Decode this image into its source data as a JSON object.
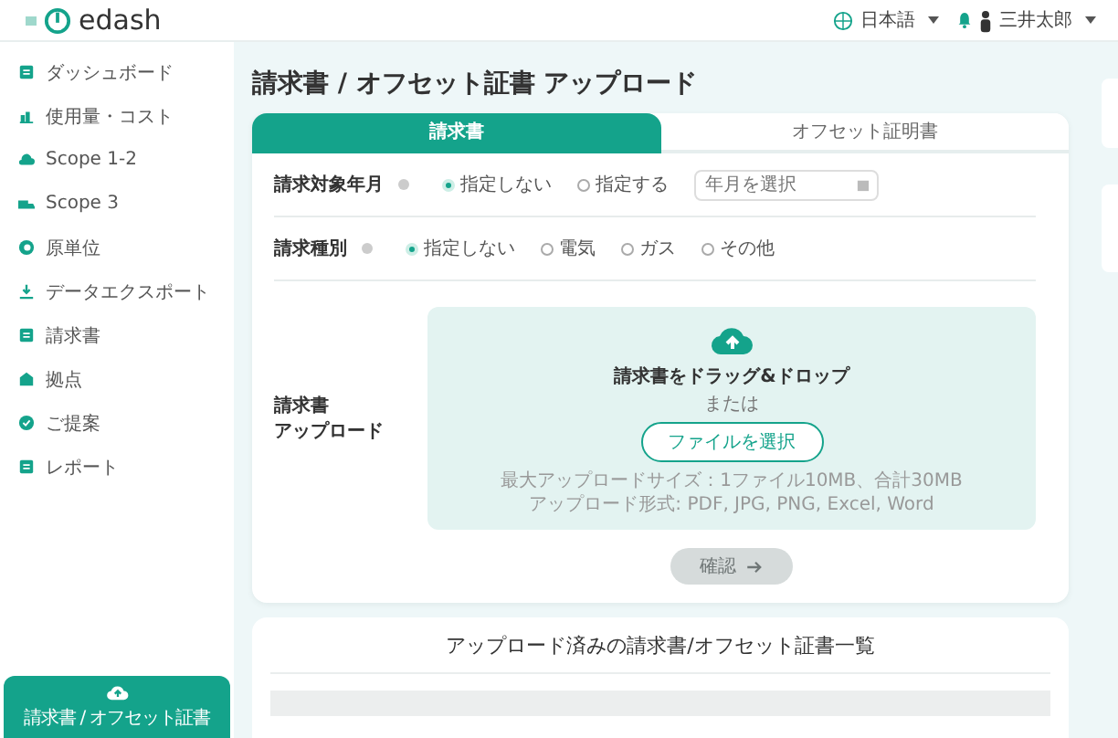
{
  "header": {
    "logo": "edash",
    "language": "日本語",
    "user": "三井太郎"
  },
  "sidebar": {
    "items": [
      {
        "label": "ダッシュボード",
        "selected": false
      },
      {
        "label": "使用量・コスト",
        "selected": false
      },
      {
        "label": "Scope 1-2",
        "selected": false
      },
      {
        "label": "Scope 3",
        "selected": false
      },
      {
        "label": "原単位",
        "selected": false
      },
      {
        "label": "データエクスポート",
        "selected": false
      },
      {
        "label": "請求書",
        "selected": false
      },
      {
        "label": "拠点",
        "selected": false
      },
      {
        "label": "ご提案",
        "selected": false
      },
      {
        "label": "レポート",
        "selected": false
      }
    ],
    "upload_button": "請求書 / オフセット証書"
  },
  "page_title": "請求書 / オフセット証書 アップロード",
  "tabs": [
    {
      "label": "請求書",
      "selected": true
    },
    {
      "label": "オフセット証明書",
      "selected": false
    }
  ],
  "form": {
    "rows": [
      {
        "label": "請求対象年月",
        "options": [
          {
            "label": "指定しない",
            "selected": true
          },
          {
            "label": "指定する",
            "selected": false
          }
        ],
        "date_placeholder": "年月を選択"
      },
      {
        "label": "請求種別",
        "options": [
          {
            "label": "指定しない",
            "selected": true
          },
          {
            "label": "電気",
            "selected": false
          },
          {
            "label": "ガス",
            "selected": false
          },
          {
            "label": "その他",
            "selected": false
          }
        ]
      }
    ],
    "upload": {
      "label_lines": [
        "請求書",
        "アップロード"
      ],
      "drop_text": "請求書をドラッグ&ドロップ",
      "or_text": "または",
      "choose_button": "ファイルを選択",
      "notes": [
        "最大アップロードサイズ：1ファイル10MB、合計30MB",
        "アップロード形式: PDF, JPG, PNG, Excel, Word"
      ]
    },
    "confirm_button": {
      "label": "確認",
      "disabled": true
    }
  },
  "list": {
    "title": "アップロード済みの請求書/オフセット証書一覧"
  }
}
